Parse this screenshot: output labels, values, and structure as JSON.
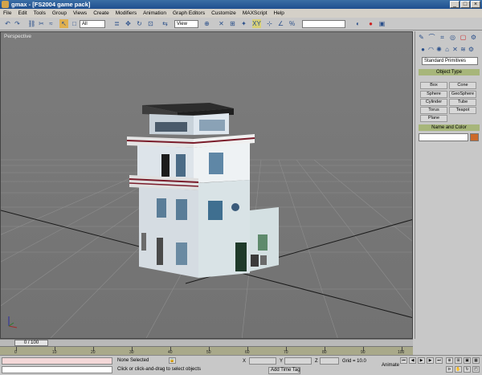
{
  "window": {
    "title": "gmax - [FS2004 game pack]",
    "min": "_",
    "max": "□",
    "close": "×"
  },
  "menu": [
    "File",
    "Edit",
    "Tools",
    "Group",
    "Views",
    "Create",
    "Modifiers",
    "Animation",
    "Graph Editors",
    "Customize",
    "MAXScript",
    "Help"
  ],
  "toolbar": {
    "selection_filter": "All",
    "reference_coord": "View",
    "named_selection": ""
  },
  "viewport": {
    "label": "Perspective",
    "bg_color": "#7a7a7a"
  },
  "command_panel": {
    "category": "Standard Primitives",
    "object_type_header": "Object Type",
    "primitives": [
      "Box",
      "Cone",
      "Sphere",
      "GeoSphere",
      "Cylinder",
      "Tube",
      "Torus",
      "Teapot",
      "Plane"
    ],
    "name_color_header": "Name and Color",
    "object_color": "#cc6a2a"
  },
  "timeline": {
    "slider_label": "0 / 100",
    "ticks": [
      "0",
      "10",
      "20",
      "30",
      "40",
      "50",
      "60",
      "70",
      "80",
      "90",
      "100"
    ]
  },
  "status": {
    "selection": "None Selected",
    "prompt": "Click or click-and-drag to select objects",
    "add_time_tag": "Add Time Tag",
    "grid": "Grid = 10.0",
    "animate": "Animate"
  }
}
